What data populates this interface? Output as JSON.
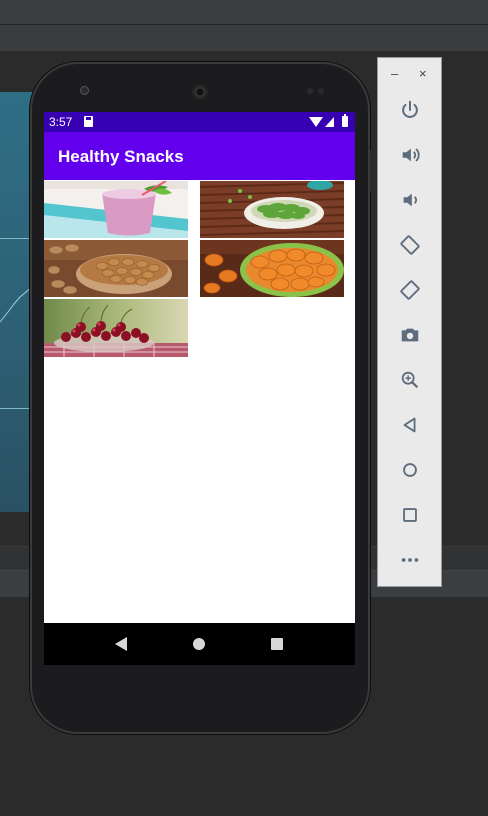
{
  "app": {
    "title": "Healthy Snacks",
    "status_time": "3:57",
    "colors": {
      "status_bar": "#3700b3",
      "app_bar": "#6200ee"
    }
  },
  "grid": {
    "items": [
      {
        "name": "smoothie",
        "icon": "smoothie-image"
      },
      {
        "name": "edamame",
        "icon": "edamame-image"
      },
      {
        "name": "almonds",
        "icon": "almonds-image"
      },
      {
        "name": "dried-apricots",
        "icon": "apricots-image"
      },
      {
        "name": "cherries",
        "icon": "cherries-image"
      }
    ]
  },
  "navigation": {
    "buttons": [
      "back-icon",
      "home-icon",
      "recents-icon"
    ]
  },
  "emulator_toolbar": {
    "window_controls": {
      "minimize": "–",
      "close": "×"
    },
    "buttons": [
      "power-icon",
      "volume-up-icon",
      "volume-down-icon",
      "rotate-left-icon",
      "rotate-right-icon",
      "camera-icon",
      "zoom-icon",
      "back-icon",
      "home-icon",
      "overview-icon",
      "more-icon"
    ]
  }
}
